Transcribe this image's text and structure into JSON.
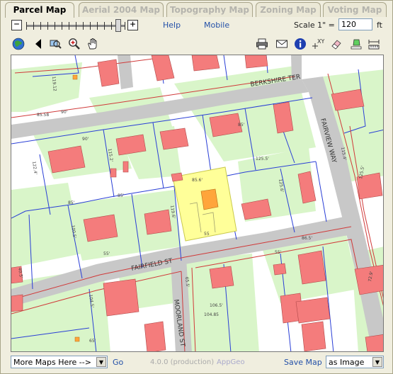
{
  "tabs": [
    {
      "label": "Parcel Map",
      "active": true
    },
    {
      "label": "Aerial 2004 Map",
      "active": false
    },
    {
      "label": "Topography Map",
      "active": false
    },
    {
      "label": "Zoning Map",
      "active": false
    },
    {
      "label": "Voting Map",
      "active": false
    }
  ],
  "toolbar": {
    "zoom_out_label": "−",
    "zoom_in_label": "+",
    "zoom_level_fraction": 0.93,
    "help_label": "Help",
    "mobile_label": "Mobile",
    "scale_label": "Scale 1\" =",
    "scale_value": "120",
    "scale_unit": "ft"
  },
  "tools": [
    {
      "name": "globe-icon",
      "icon": "globe"
    },
    {
      "name": "back-arrow-icon",
      "icon": "triangle-left"
    },
    {
      "name": "zoom-extent-icon",
      "icon": "zoom-extent"
    },
    {
      "name": "zoom-in-icon",
      "icon": "magnifier-plus"
    },
    {
      "name": "pan-hand-icon",
      "icon": "hand"
    },
    {
      "name": "print-icon",
      "icon": "printer"
    },
    {
      "name": "email-icon",
      "icon": "envelope"
    },
    {
      "name": "info-icon",
      "icon": "info"
    },
    {
      "name": "xy-coordinate-icon",
      "icon": "xy"
    },
    {
      "name": "eraser-icon",
      "icon": "eraser"
    },
    {
      "name": "highlight-icon",
      "icon": "marker"
    },
    {
      "name": "measure-icon",
      "icon": "ruler"
    }
  ],
  "map": {
    "streets": {
      "berkshire": "BERKSHIRE TER",
      "fairview": "FAIRVIEW WAY",
      "fairfield": "FAIRFIELD ST",
      "mooreland": "MOORLAND ST"
    },
    "dimensions": [
      "119.12",
      "85.58",
      "90'",
      "122.4'",
      "90'",
      "115.2'",
      "119.6'",
      "100.5'",
      "125.6'",
      "85'",
      "85'",
      "55'",
      "125.5'",
      "85.6'",
      "55",
      "65'",
      "104.85",
      "65.5'",
      "106.5'",
      "86.5'",
      "55'",
      "115.4'",
      "125.5'",
      "40.5'",
      "104.5'",
      "85'",
      "72.9'"
    ],
    "colors": {
      "building": "#f47c7c",
      "selected_parcel": "#ffff99",
      "selected_building": "#ffa53b",
      "lawn": "#d9f5c9",
      "road": "#c8c8c8",
      "parcel_line_blue": "#2a3fd6",
      "parcel_line_red": "#d03a3a"
    }
  },
  "footer": {
    "more_maps_label": "More Maps Here -->",
    "go_label": "Go",
    "version": "4.0.0 (production)",
    "appgeo": "AppGeo",
    "save_map_label": "Save Map",
    "as_image_label": "as Image"
  }
}
